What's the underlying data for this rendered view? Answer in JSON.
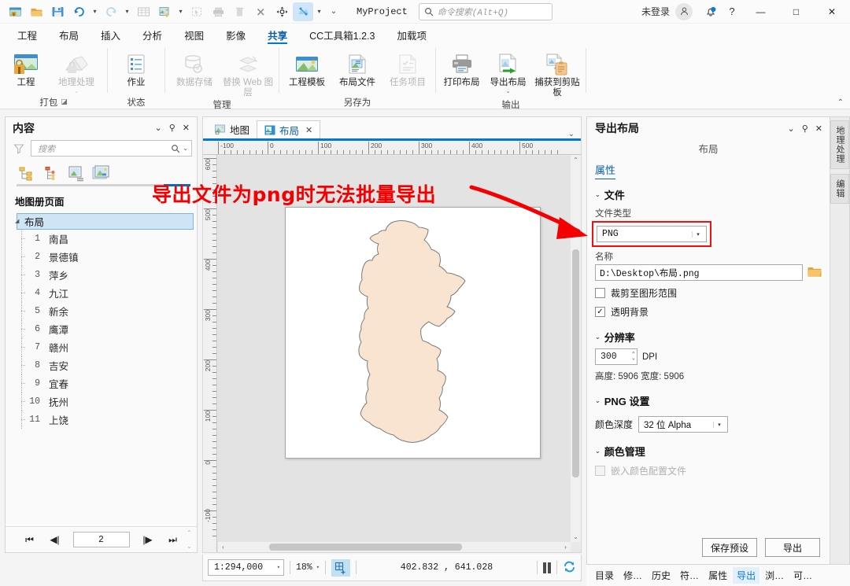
{
  "titlebar": {
    "quick_access": [
      {
        "name": "new-project-icon",
        "label": "新建"
      },
      {
        "name": "open-project-icon",
        "label": "打开"
      },
      {
        "name": "save-project-icon",
        "label": "保存"
      },
      {
        "name": "undo-icon",
        "label": "撤销"
      },
      {
        "name": "redo-icon",
        "label": "重做"
      },
      {
        "name": "table-icon",
        "label": "表"
      },
      {
        "name": "add-data-icon",
        "label": "添加数据"
      },
      {
        "name": "select-icon",
        "label": "选择"
      },
      {
        "name": "print-icon",
        "label": "打印"
      },
      {
        "name": "delete-icon",
        "label": "删除"
      },
      {
        "name": "clear-icon",
        "label": "清除"
      },
      {
        "name": "pan-icon",
        "label": "平移"
      },
      {
        "name": "explore-icon",
        "label": "浏览"
      },
      {
        "name": "customize-icon",
        "label": "自定义"
      }
    ],
    "project_name": "MyProject",
    "search_placeholder": "命令搜索(Alt+Q)",
    "sign_in": "未登录",
    "help": "?",
    "minimize": "—",
    "maximize": "□",
    "close": "✕"
  },
  "ribbon": {
    "tabs": [
      {
        "label": "工程",
        "active": false
      },
      {
        "label": "布局",
        "active": false
      },
      {
        "label": "插入",
        "active": false
      },
      {
        "label": "分析",
        "active": false
      },
      {
        "label": "视图",
        "active": false
      },
      {
        "label": "影像",
        "active": false
      },
      {
        "label": "共享",
        "active": true
      },
      {
        "label": "CC工具箱1.2.3",
        "active": false
      },
      {
        "label": "加载项",
        "active": false
      }
    ],
    "groups": [
      {
        "label": "打包",
        "has_launcher": true,
        "items": [
          {
            "label": "工程",
            "icon": "package-project-icon",
            "disabled": false,
            "dropdown": false
          },
          {
            "label": "地理处理",
            "icon": "package-geoprocessing-icon",
            "disabled": true,
            "dropdown": true
          }
        ]
      },
      {
        "label": "状态",
        "has_launcher": false,
        "items": [
          {
            "label": "作业",
            "icon": "jobs-icon",
            "disabled": false,
            "dropdown": false
          }
        ]
      },
      {
        "label": "管理",
        "has_launcher": false,
        "items": [
          {
            "label": "数据存储",
            "icon": "data-store-icon",
            "disabled": true,
            "dropdown": false
          },
          {
            "label": "替换 Web 图层",
            "icon": "replace-web-layer-icon",
            "disabled": true,
            "dropdown": false
          }
        ]
      },
      {
        "label": "另存为",
        "has_launcher": false,
        "items": [
          {
            "label": "工程模板",
            "icon": "project-template-icon",
            "disabled": false,
            "dropdown": false
          },
          {
            "label": "布局文件",
            "icon": "layout-file-icon",
            "disabled": false,
            "dropdown": false
          },
          {
            "label": "任务项目",
            "icon": "task-item-icon",
            "disabled": true,
            "dropdown": false
          }
        ]
      },
      {
        "label": "输出",
        "has_launcher": false,
        "items": [
          {
            "label": "打印布局",
            "icon": "print-layout-icon",
            "disabled": false,
            "dropdown": false
          },
          {
            "label": "导出布局",
            "icon": "export-layout-icon",
            "disabled": false,
            "dropdown": true
          },
          {
            "label": "捕获到剪贴板",
            "icon": "capture-clipboard-icon",
            "disabled": false,
            "dropdown": false
          }
        ]
      }
    ]
  },
  "contents_panel": {
    "title": "内容",
    "header_buttons": [
      "chevron-down-icon",
      "pin-icon",
      "close-icon"
    ],
    "search_placeholder": "搜索",
    "view_icons": [
      "list-by-drawing-order-icon",
      "list-by-data-source-icon",
      "list-by-selection-icon",
      "list-by-map-series-icon"
    ],
    "section_label": "地图册页面",
    "root": "布局",
    "pages": [
      {
        "num": "1",
        "name": "南昌"
      },
      {
        "num": "2",
        "name": "景德镇"
      },
      {
        "num": "3",
        "name": "萍乡"
      },
      {
        "num": "4",
        "name": "九江"
      },
      {
        "num": "5",
        "name": "新余"
      },
      {
        "num": "6",
        "name": "鹰潭"
      },
      {
        "num": "7",
        "name": "赣州"
      },
      {
        "num": "8",
        "name": "吉安"
      },
      {
        "num": "9",
        "name": "宜春"
      },
      {
        "num": "10",
        "name": "抚州"
      },
      {
        "num": "11",
        "name": "上饶"
      }
    ],
    "page_nav": {
      "first": "⏮",
      "prev": "◀|",
      "value": "2",
      "next": "|▶",
      "last": "⏭"
    }
  },
  "view": {
    "tabs": [
      {
        "label": "地图",
        "active": false,
        "closable": false,
        "icon": "map-icon"
      },
      {
        "label": "布局",
        "active": true,
        "closable": true,
        "icon": "layout-icon"
      }
    ],
    "h_ruler_labels": [
      "-100",
      "0",
      "100",
      "200",
      "300",
      "400",
      "500"
    ],
    "v_ruler_labels": [
      "600",
      "500",
      "400",
      "300",
      "200",
      "100",
      "0",
      "-100"
    ]
  },
  "statusbar": {
    "scale": "1:294,000",
    "zoom": "18%",
    "grid_icon": "snap-grid-icon",
    "coordinates": "402.832 , 641.028",
    "pause_icon": "pause-drawing-icon",
    "refresh_icon": "refresh-icon"
  },
  "export_panel": {
    "title": "导出布局",
    "header_buttons": [
      "chevron-down-icon",
      "pin-icon",
      "close-icon"
    ],
    "subtitle": "布局",
    "tab": "属性",
    "file_section": {
      "title": "文件",
      "file_type_label": "文件类型",
      "file_type_value": "PNG",
      "name_label": "名称",
      "name_value": "D:\\Desktop\\布局.png",
      "browse_icon": "folder-icon",
      "clip_checkbox_label": "裁剪至图形范围",
      "clip_checked": false,
      "transparent_checkbox_label": "透明背景",
      "transparent_checked": true
    },
    "resolution_section": {
      "title": "分辨率",
      "dpi_value": "300",
      "dpi_unit": "DPI",
      "dimensions": "高度: 5906  宽度: 5906"
    },
    "png_section": {
      "title": "PNG 设置",
      "color_depth_label": "颜色深度",
      "color_depth_value": "32 位 Alpha"
    },
    "color_management_section": {
      "title": "颜色管理",
      "embed_label": "嵌入颜色配置文件",
      "embed_checked": false,
      "embed_disabled": true
    },
    "save_preset_button": "保存预设",
    "export_button": "导出",
    "side_tabs": [
      "地理处理",
      "编辑"
    ]
  },
  "bottom_tabs": [
    {
      "label": "目录",
      "active": false
    },
    {
      "label": "修…",
      "active": false
    },
    {
      "label": "历史",
      "active": false
    },
    {
      "label": "符…",
      "active": false
    },
    {
      "label": "属性",
      "active": false
    },
    {
      "label": "导出",
      "active": true
    },
    {
      "label": "浏…",
      "active": false
    },
    {
      "label": "可…",
      "active": false
    }
  ],
  "annotation": {
    "text": "导出文件为png时无法批量导出",
    "color": "#f40000",
    "arrow_icon": "red-arrow-icon",
    "highlight_color": "#ee1111"
  }
}
